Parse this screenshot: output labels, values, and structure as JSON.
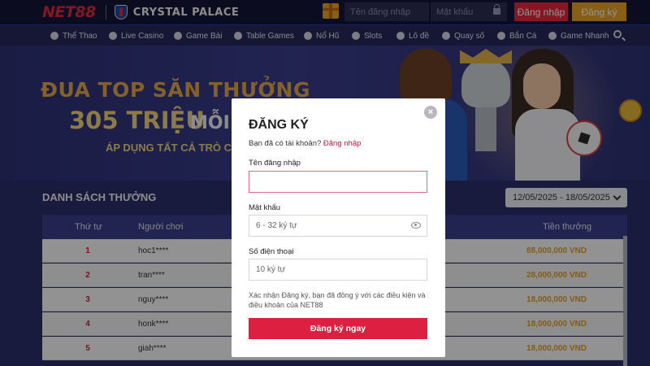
{
  "header": {
    "logo": "NET88",
    "club_name": "CRYSTAL PALACE",
    "username_placeholder": "Tên đăng nhập",
    "password_placeholder": "Mật khẩu",
    "login_button": "Đăng nhập",
    "register_button": "Đăng ký"
  },
  "nav": {
    "items": [
      {
        "label": "Thể Thao",
        "icon": "sports-icon"
      },
      {
        "label": "Live Casino",
        "icon": "live-casino-icon"
      },
      {
        "label": "Game Bài",
        "icon": "cards-icon"
      },
      {
        "label": "Table Games",
        "icon": "table-games-icon"
      },
      {
        "label": "Nổ Hũ",
        "icon": "jackpot-icon"
      },
      {
        "label": "Slots",
        "icon": "slots-icon"
      },
      {
        "label": "Lô đề",
        "icon": "lottery-icon"
      },
      {
        "label": "Quay số",
        "icon": "spin-icon"
      },
      {
        "label": "Bắn Cá",
        "icon": "fish-icon"
      },
      {
        "label": "Game Nhanh",
        "icon": "rocket-icon"
      }
    ]
  },
  "banner": {
    "line1": "ĐUA TOP SĂN THƯỞNG",
    "prize": "305 TRIỆU",
    "suffix": "MỖI T",
    "subline": "ÁP DỤNG TẤT CẢ TRÒ CHO"
  },
  "leaderboard": {
    "title": "DANH SÁCH THƯỞNG",
    "date_range": "12/05/2025 - 18/05/2025",
    "columns": [
      "Thứ tự",
      "Người chơi",
      "Tiền thưởng"
    ],
    "rows": [
      {
        "rank": "1",
        "player": "hoc1****",
        "prize": "88,000,000 VND"
      },
      {
        "rank": "2",
        "player": "tran****",
        "prize": "28,000,000 VND"
      },
      {
        "rank": "3",
        "player": "nguy****",
        "prize": "18,000,000 VND"
      },
      {
        "rank": "4",
        "player": "honk****",
        "prize": "18,000,000 VND"
      },
      {
        "rank": "5",
        "player": "giah****",
        "prize": "18,000,000 VND"
      }
    ]
  },
  "modal": {
    "title": "ĐĂNG KÝ",
    "subtitle_prefix": "Bạn đã có tài khoản?",
    "subtitle_link": "Đăng nhập",
    "username_label": "Tên đăng nhập",
    "username_value": "",
    "password_label": "Mật khẩu",
    "password_placeholder": "6 - 32 ký tự",
    "phone_label": "Số điện thoại",
    "phone_placeholder": "10 ký tự",
    "terms": "Xác nhận Đăng ký, bạn đã đồng ý với các điều kiện và điều khoản của NET88",
    "submit": "Đăng ký ngay",
    "close": "×"
  },
  "colors": {
    "brand_red": "#e3283d",
    "accent_gold": "#e8a326",
    "page_bg": "#2a2f6b"
  }
}
